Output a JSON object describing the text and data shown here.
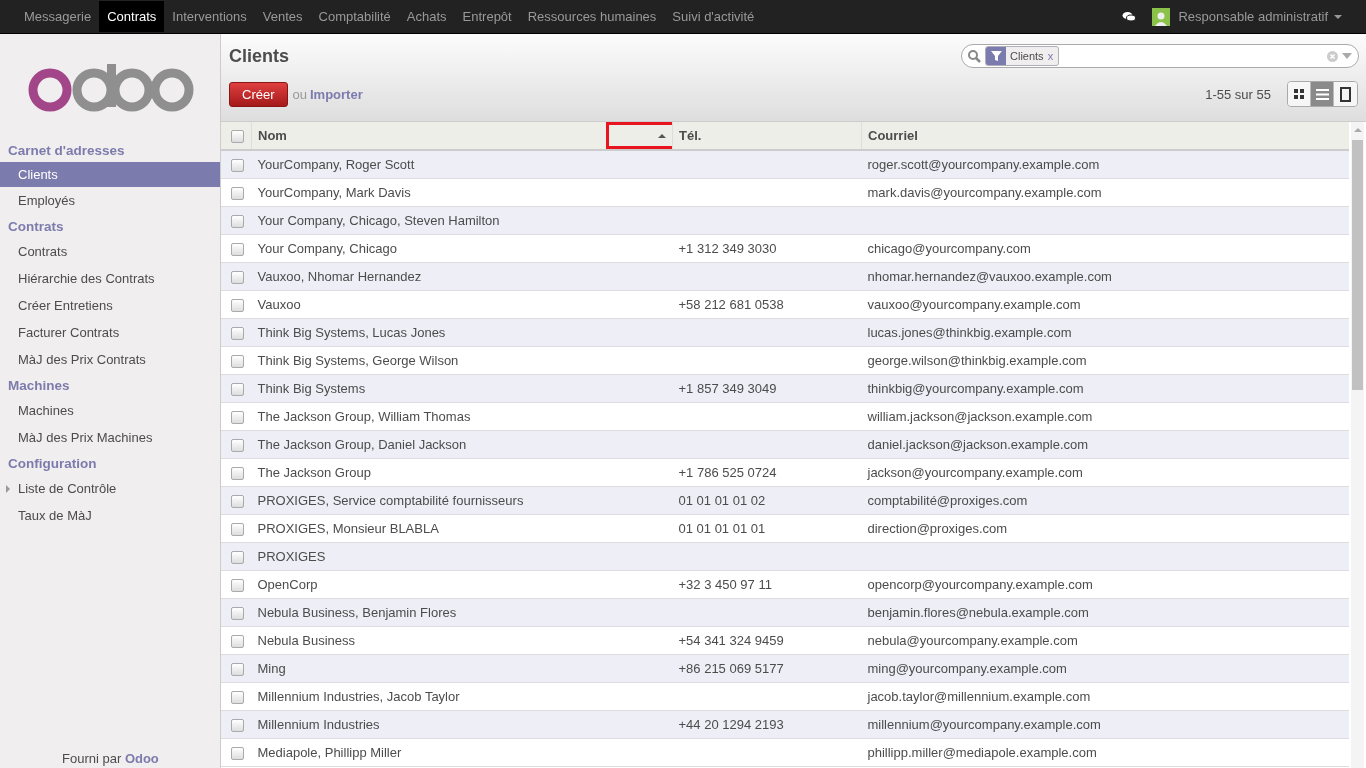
{
  "top_menu": [
    {
      "label": "Messagerie",
      "selected": false
    },
    {
      "label": "Contrats",
      "selected": true
    },
    {
      "label": "Interventions",
      "selected": false
    },
    {
      "label": "Ventes",
      "selected": false
    },
    {
      "label": "Comptabilité",
      "selected": false
    },
    {
      "label": "Achats",
      "selected": false
    },
    {
      "label": "Entrepôt",
      "selected": false
    },
    {
      "label": "Ressources humaines",
      "selected": false
    },
    {
      "label": "Suivi d'activité",
      "selected": false
    }
  ],
  "user": {
    "name": "Responsable administratif"
  },
  "sidebar": {
    "sections": [
      {
        "title": "Carnet d'adresses",
        "items": [
          {
            "label": "Clients",
            "selected": true,
            "kind": "link"
          },
          {
            "label": "Employés",
            "selected": false,
            "kind": "link"
          }
        ]
      },
      {
        "title": "Contrats",
        "items": [
          {
            "label": "Contrats",
            "selected": false,
            "kind": "link"
          },
          {
            "label": "Hiérarchie des Contrats",
            "selected": false,
            "kind": "link"
          },
          {
            "label": "Créer Entretiens",
            "selected": false,
            "kind": "link"
          },
          {
            "label": "Facturer Contrats",
            "selected": false,
            "kind": "link"
          },
          {
            "label": "MàJ des Prix Contrats",
            "selected": false,
            "kind": "link"
          }
        ]
      },
      {
        "title": "Machines",
        "items": [
          {
            "label": "Machines",
            "selected": false,
            "kind": "link"
          },
          {
            "label": "MàJ des Prix Machines",
            "selected": false,
            "kind": "link"
          }
        ]
      },
      {
        "title": "Configuration",
        "items": [
          {
            "label": "Liste de Contrôle",
            "selected": false,
            "kind": "folder"
          },
          {
            "label": "Taux de MàJ",
            "selected": false,
            "kind": "link"
          }
        ]
      }
    ],
    "footer_prefix": "Fourni par",
    "footer_link": "Odoo"
  },
  "page": {
    "title": "Clients",
    "create_button": "Créer",
    "or": "ou",
    "import_link": "Importer",
    "pager": "1-55 sur 55",
    "search": {
      "facets": [
        "Clients"
      ],
      "facet_remove": "x"
    },
    "views": [
      {
        "kind": "kanban",
        "selected": false
      },
      {
        "kind": "list",
        "selected": true
      },
      {
        "kind": "form",
        "selected": false
      }
    ]
  },
  "table": {
    "select_all": {
      "checked": false
    },
    "columns": [
      "Nom",
      "Tél.",
      "Courriel"
    ],
    "rows": [
      {
        "name": "YourCompany, Roger Scott",
        "phone": "",
        "email": "roger.scott@yourcompany.example.com",
        "checked": false
      },
      {
        "name": "YourCompany, Mark Davis",
        "phone": "",
        "email": "mark.davis@yourcompany.example.com",
        "checked": false
      },
      {
        "name": "Your Company, Chicago, Steven Hamilton",
        "phone": "",
        "email": "",
        "checked": false
      },
      {
        "name": "Your Company, Chicago",
        "phone": "+1 312 349 3030",
        "email": "chicago@yourcompany.com",
        "checked": false
      },
      {
        "name": "Vauxoo, Nhomar Hernandez",
        "phone": "",
        "email": "nhomar.hernandez@vauxoo.example.com",
        "checked": false
      },
      {
        "name": "Vauxoo",
        "phone": "+58 212 681 0538",
        "email": "vauxoo@yourcompany.example.com",
        "checked": false
      },
      {
        "name": "Think Big Systems, Lucas Jones",
        "phone": "",
        "email": "lucas.jones@thinkbig.example.com",
        "checked": false
      },
      {
        "name": "Think Big Systems, George Wilson",
        "phone": "",
        "email": "george.wilson@thinkbig.example.com",
        "checked": false
      },
      {
        "name": "Think Big Systems",
        "phone": "+1 857 349 3049",
        "email": "thinkbig@yourcompany.example.com",
        "checked": false
      },
      {
        "name": "The Jackson Group, William Thomas",
        "phone": "",
        "email": "william.jackson@jackson.example.com",
        "checked": false
      },
      {
        "name": "The Jackson Group, Daniel Jackson",
        "phone": "",
        "email": "daniel.jackson@jackson.example.com",
        "checked": false
      },
      {
        "name": "The Jackson Group",
        "phone": "+1 786 525 0724",
        "email": "jackson@yourcompany.example.com",
        "checked": false
      },
      {
        "name": "PROXIGES, Service comptabilité fournisseurs",
        "phone": "01 01 01 01 02",
        "email": "comptabilité@proxiges.com",
        "checked": false
      },
      {
        "name": "PROXIGES, Monsieur BLABLA",
        "phone": "01 01 01 01 01",
        "email": "direction@proxiges.com",
        "checked": false
      },
      {
        "name": "PROXIGES",
        "phone": "",
        "email": "",
        "checked": false
      },
      {
        "name": "OpenCorp",
        "phone": "+32 3 450 97 11",
        "email": "opencorp@yourcompany.example.com",
        "checked": false
      },
      {
        "name": "Nebula Business, Benjamin Flores",
        "phone": "",
        "email": "benjamin.flores@nebula.example.com",
        "checked": false
      },
      {
        "name": "Nebula Business",
        "phone": "+54 341 324 9459",
        "email": "nebula@yourcompany.example.com",
        "checked": false
      },
      {
        "name": "Ming",
        "phone": "+86 215 069 5177",
        "email": "ming@yourcompany.example.com",
        "checked": false
      },
      {
        "name": "Millennium Industries, Jacob Taylor",
        "phone": "",
        "email": "jacob.taylor@millennium.example.com",
        "checked": false
      },
      {
        "name": "Millennium Industries",
        "phone": "+44 20 1294 2193",
        "email": "millennium@yourcompany.example.com",
        "checked": false
      },
      {
        "name": "Mediapole, Phillipp Miller",
        "phone": "",
        "email": "phillipp.miller@mediapole.example.com",
        "checked": false
      }
    ]
  }
}
